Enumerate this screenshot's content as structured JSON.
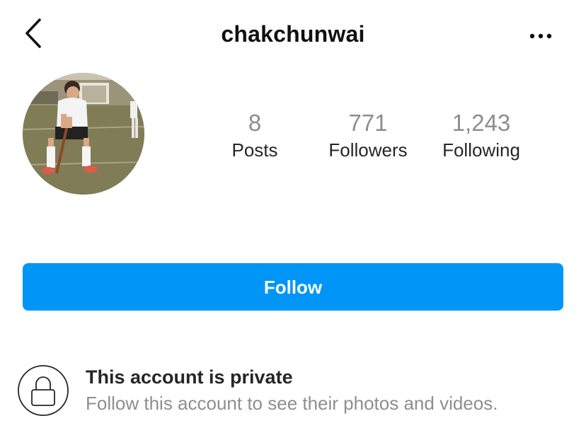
{
  "header": {
    "back_icon": "chevron-left-icon",
    "username": "chakchunwai",
    "more_icon": "more-horizontal-icon"
  },
  "profile": {
    "avatar_description_icon": "avatar-photo",
    "stats": [
      {
        "value": "8",
        "label": "Posts"
      },
      {
        "value": "771",
        "label": "Followers"
      },
      {
        "value": "1,243",
        "label": "Following"
      }
    ]
  },
  "actions": {
    "follow_label": "Follow",
    "follow_color": "#0095f6"
  },
  "private_notice": {
    "icon": "lock-icon",
    "title": "This account is private",
    "subtitle": "Follow this account to see their photos and videos."
  }
}
